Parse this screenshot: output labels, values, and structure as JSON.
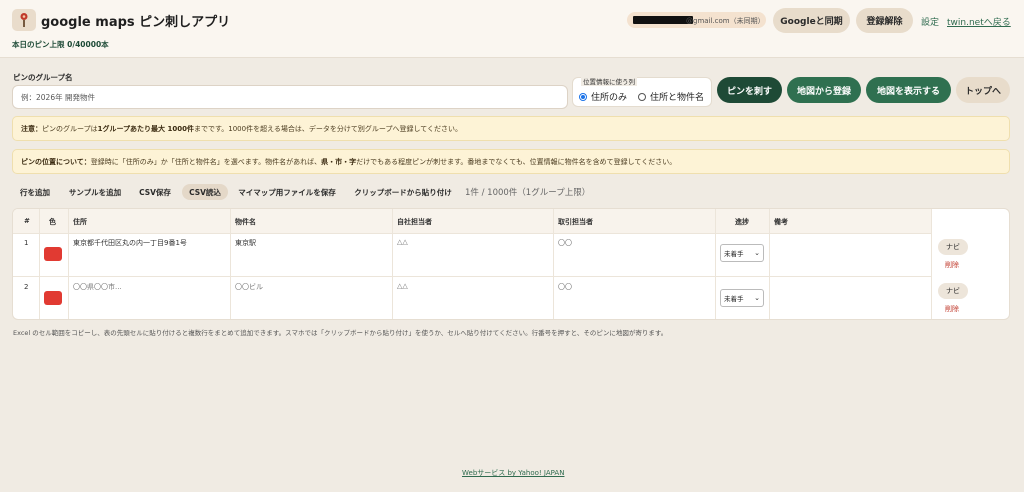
{
  "header": {
    "title": "google maps ピン刺しアプリ",
    "pin_limit": "本日のピン上限 0/40000本",
    "email_suffix": "@gmail.com（未同期）",
    "sync_button": "Googleと同期",
    "unlink_button": "登録解除",
    "settings_link": "設定",
    "back_link": "twin.netへ戻る",
    "logo_icon": "pin-icon"
  },
  "form": {
    "group_label": "ピンのグループ名",
    "group_placeholder": "例：2026年 開発物件",
    "location_title": "位置情報に使う列",
    "radio_address_only": "住所のみ",
    "radio_address_and_name": "住所と物件名",
    "selected_radio": "住所のみ",
    "pin_button": "ピンを刺す",
    "register_button": "地図から登録",
    "show_map_button": "地図を表示する",
    "top_button": "トップへ"
  },
  "notices": {
    "caution_label": "注意：",
    "caution_text_1": "ピンのグループは",
    "caution_bold": "1グループあたり最大 1000件",
    "caution_text_2": "までです。1000件を超える場合は、データを分けて別グループへ登録してください。",
    "position_label": "ピンの位置について：",
    "position_text_1": "登録時に「住所のみ」か「住所と物件名」を選べます。物件名があれば、",
    "position_bold": "県・市・字",
    "position_text_2": "だけでもある程度ピンが刺せます。番地までなくても、位置情報に物件名を含めて登録してください。"
  },
  "toolbar": {
    "add_row": "行を追加",
    "add_sample": "サンプルを追加",
    "csv_save": "CSV保存",
    "csv_load": "CSV読込",
    "save_mymap": "マイマップ用ファイルを保存",
    "paste_clipboard": "クリップボードから貼り付け",
    "count": "1件 / 1000件（1グループ上限）"
  },
  "table": {
    "headers": [
      "#",
      "色",
      "住所",
      "物件名",
      "自社担当者",
      "取引担当者",
      "進捗",
      "備考"
    ],
    "rows": [
      {
        "num": "1",
        "address": "東京都千代田区丸の内一丁目9番1号",
        "property": "東京駅",
        "own_rep": "△△",
        "partner_rep": "〇〇",
        "status": "未着手",
        "navi": "ナビ",
        "delete": "削除",
        "color": "#e13a32"
      },
      {
        "num": "2",
        "address": "〇〇県〇〇市...",
        "property": "〇〇ビル",
        "own_rep": "△△",
        "partner_rep": "〇〇",
        "status": "未着手",
        "navi": "ナビ",
        "delete": "削除",
        "color": "#e13a32"
      }
    ]
  },
  "footnote": "Excel のセル範囲をコピーし、表の先頭セルに貼り付けると複数行をまとめて追加できます。スマホでは「クリップボードから貼り付け」を使うか、セルへ貼り付けてください。行番号を押すと、そのピンに地図が寄ります。",
  "footer_link": "Webサービス by Yahoo! JAPAN",
  "colors": {
    "brand_dark": "#1e4a36",
    "brand_mid": "#2f7050",
    "pin_red": "#e13a32",
    "background": "#f0ebe3"
  }
}
